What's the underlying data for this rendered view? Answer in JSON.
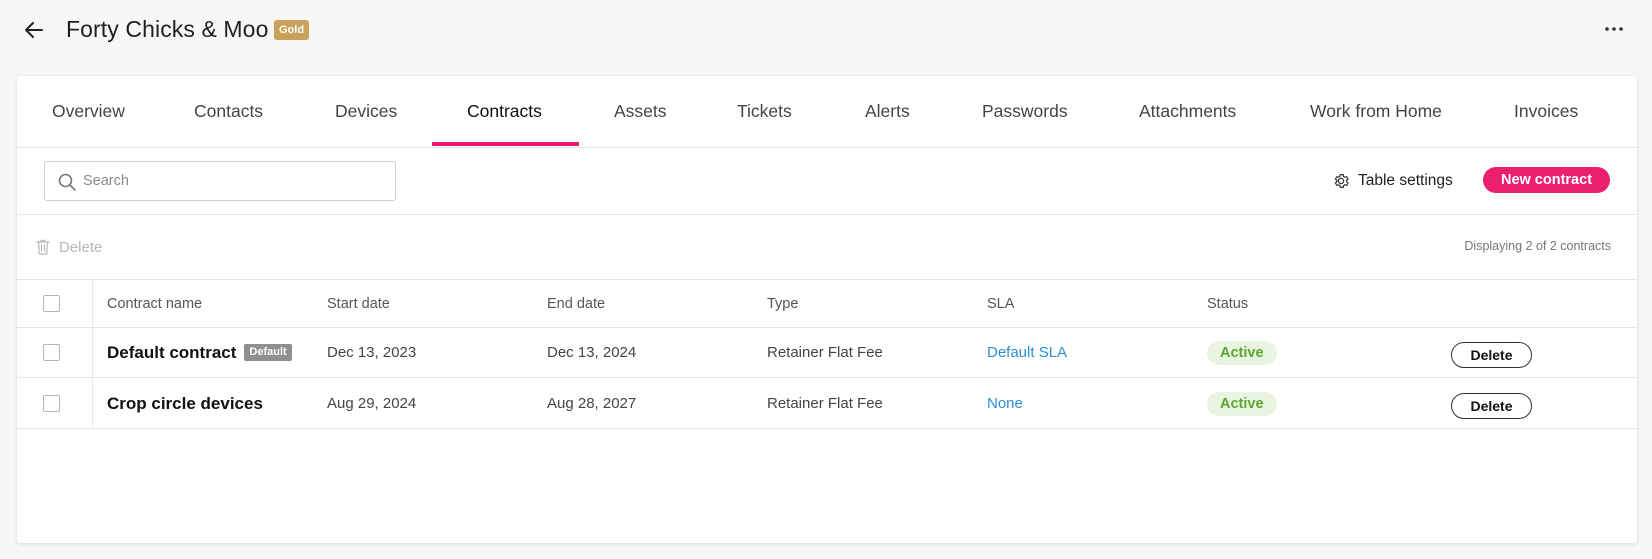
{
  "header": {
    "title": "Forty Chicks & Moo",
    "tier_badge": "Gold",
    "more_label": "···"
  },
  "tabs": [
    {
      "label": "Overview",
      "active": false
    },
    {
      "label": "Contacts",
      "active": false
    },
    {
      "label": "Devices",
      "active": false
    },
    {
      "label": "Contracts",
      "active": true
    },
    {
      "label": "Assets",
      "active": false
    },
    {
      "label": "Tickets",
      "active": false
    },
    {
      "label": "Alerts",
      "active": false
    },
    {
      "label": "Passwords",
      "active": false
    },
    {
      "label": "Attachments",
      "active": false
    },
    {
      "label": "Work from Home",
      "active": false
    },
    {
      "label": "Invoices",
      "active": false
    }
  ],
  "toolbar": {
    "search_placeholder": "Search",
    "table_settings_label": "Table settings",
    "new_contract_label": "New contract"
  },
  "actions": {
    "bulk_delete_label": "Delete",
    "display_count": "Displaying 2 of 2 contracts"
  },
  "table": {
    "columns": [
      "Contract name",
      "Start date",
      "End date",
      "Type",
      "SLA",
      "Status"
    ],
    "rows": [
      {
        "name": "Default contract",
        "tag": "Default",
        "start_date": "Dec 13, 2023",
        "end_date": "Dec 13, 2024",
        "type": "Retainer Flat Fee",
        "sla": "Default SLA",
        "status": "Active",
        "delete_label": "Delete"
      },
      {
        "name": "Crop circle devices",
        "tag": "",
        "start_date": "Aug 29, 2024",
        "end_date": "Aug 28, 2027",
        "type": "Retainer Flat Fee",
        "sla": "None",
        "status": "Active",
        "delete_label": "Delete"
      }
    ]
  },
  "colors": {
    "accent": "#ec1f6e",
    "tier_badge": "#c9a15b",
    "link": "#2b8fd6",
    "status_active_text": "#5ca52f",
    "status_active_bg": "#eaf4e2"
  },
  "icons": {
    "back": "arrow-left-icon",
    "more": "more-horizontal-icon",
    "search": "search-icon",
    "settings": "gear-icon",
    "trash": "trash-icon"
  }
}
